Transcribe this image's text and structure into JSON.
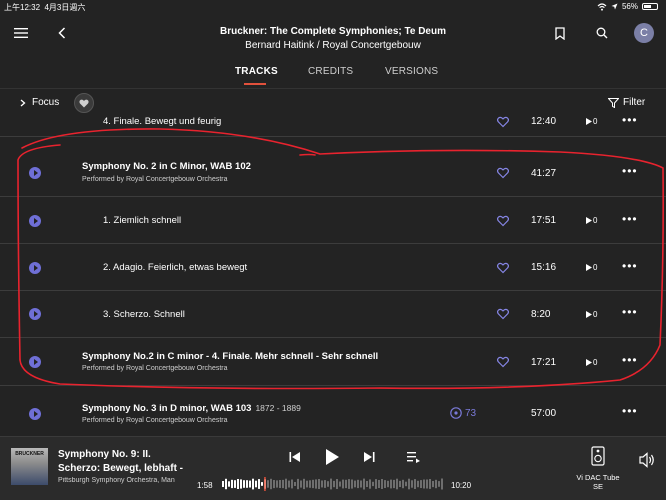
{
  "status": {
    "time": "上午12:32",
    "date": "4月3日週六",
    "battery": "56%"
  },
  "header": {
    "title": "Bruckner: The Complete Symphonies; Te Deum",
    "subtitle": "Bernard Haitink / Royal Concertgebouw",
    "avatar_letter": "C"
  },
  "tabs": [
    {
      "label": "TRACKS",
      "active": true
    },
    {
      "label": "CREDITS",
      "active": false
    },
    {
      "label": "VERSIONS",
      "active": false
    }
  ],
  "filters": {
    "focus_label": "Focus",
    "filter_label": "Filter"
  },
  "tracks": [
    {
      "title": "4. Finale. Bewegt und feurig",
      "duration": "12:40",
      "plays": "0"
    },
    {
      "title": "Symphony No. 2 in C Minor, WAB 102",
      "performer": "Performed by Royal Concertgebouw Orchestra",
      "duration": "41:27"
    },
    {
      "title": "1. Ziemlich schnell",
      "duration": "17:51",
      "plays": "0"
    },
    {
      "title": "2. Adagio. Feierlich, etwas bewegt",
      "duration": "15:16",
      "plays": "0"
    },
    {
      "title": "3. Scherzo. Schnell",
      "duration": "8:20",
      "plays": "0"
    },
    {
      "title": "Symphony No.2 in C minor - 4. Finale. Mehr schnell - Sehr schnell",
      "performer": "Performed by Royal Concertgebouw Orchestra",
      "duration": "17:21",
      "plays": "0"
    },
    {
      "title": "Symphony No. 3 in D minor, WAB 103",
      "years": "1872 - 1889",
      "performer": "Performed by Royal Concertgebouw Orchestra",
      "views": "73",
      "duration": "57:00"
    }
  ],
  "player": {
    "album_label": "BRUCKNER",
    "title_line1": "Symphony No. 9: II.",
    "title_line2": "Scherzo: Bewegt, lebhaft -",
    "artist": "Pittsburgh Symphony Orchestra, Man",
    "elapsed": "1:58",
    "total": "10:20",
    "progress": 0.19,
    "device_name": "Vi DAC Tube SE"
  },
  "colors": {
    "accent": "#6f6fd6",
    "tab_underline": "#e2513c",
    "annotation": "#e8232e"
  }
}
